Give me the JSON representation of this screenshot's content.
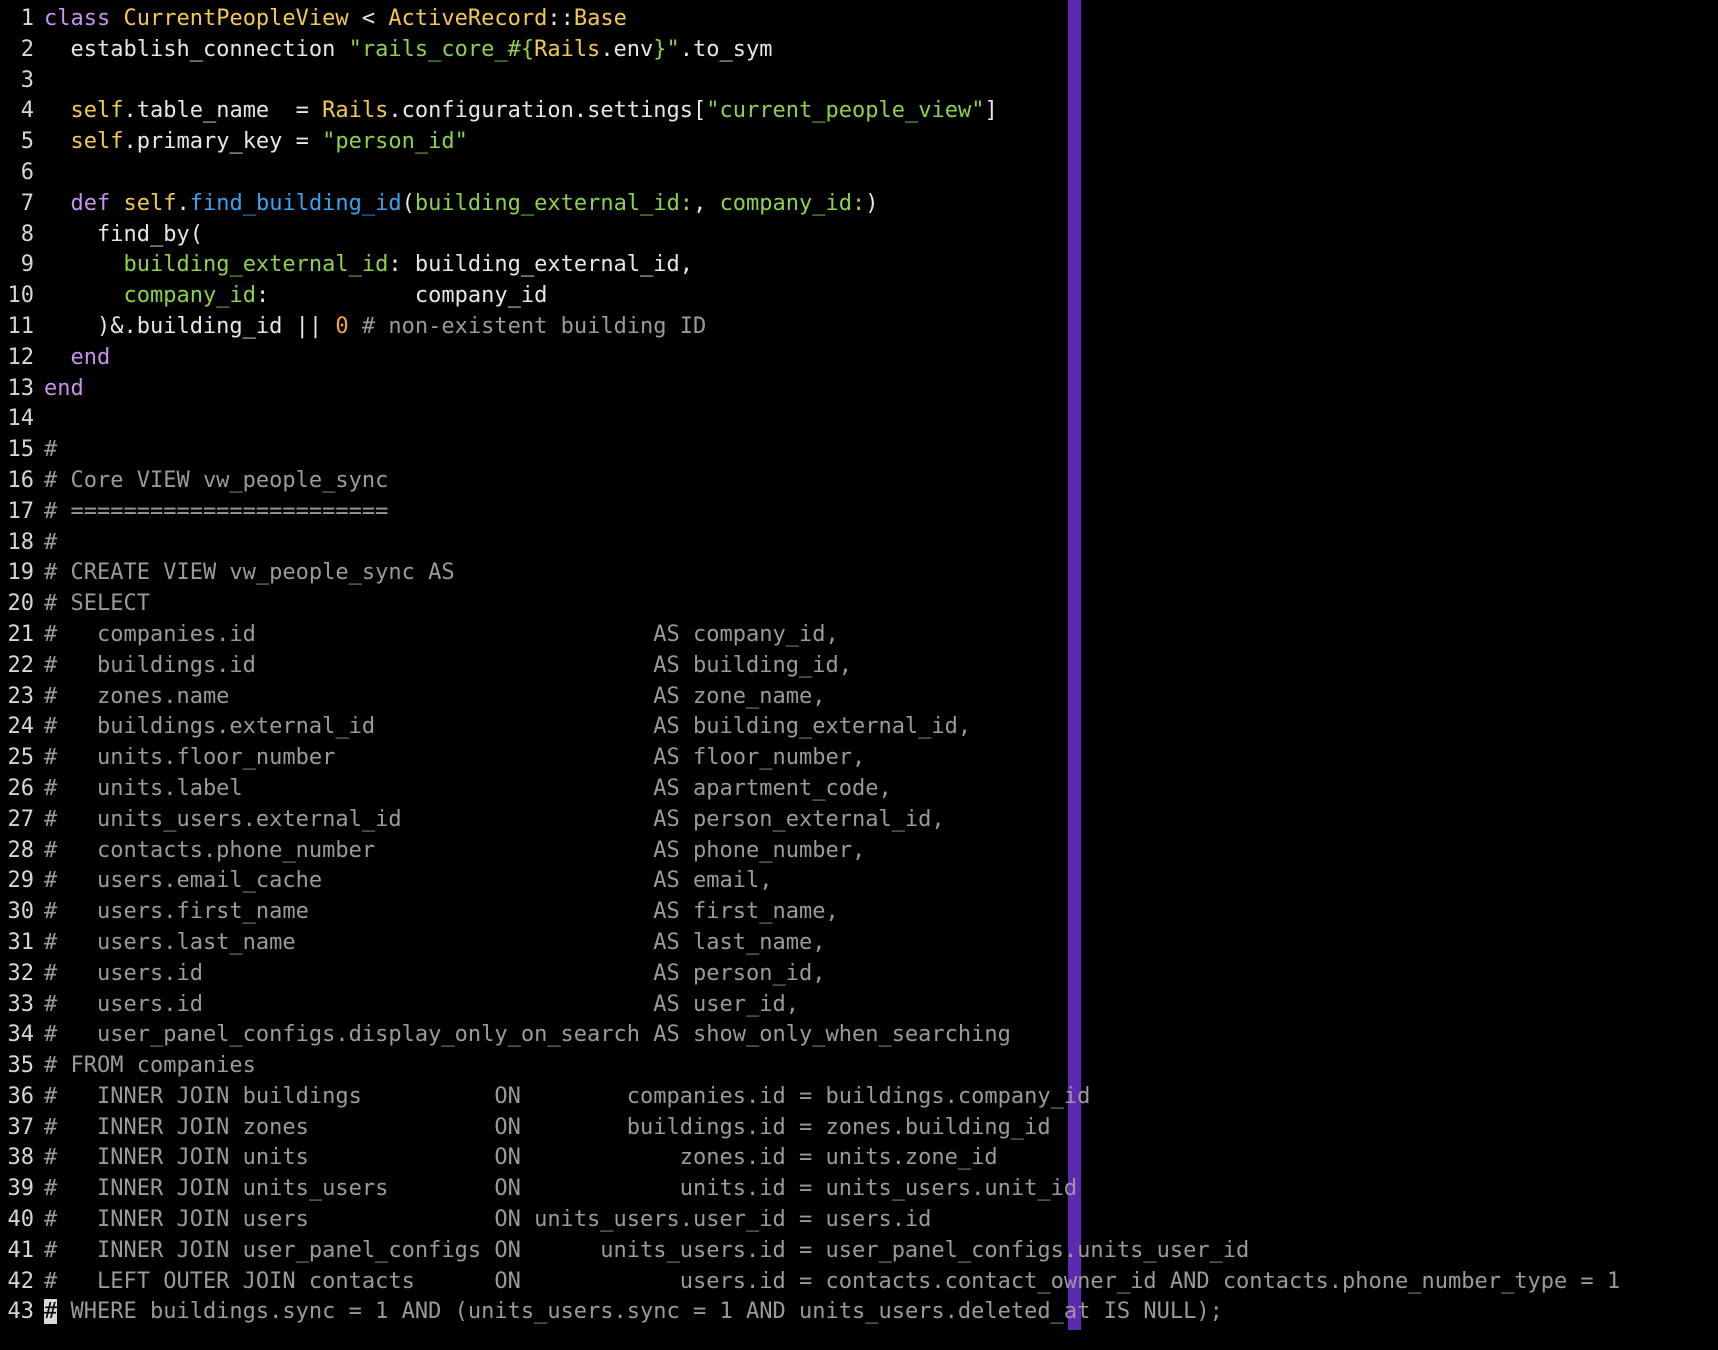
{
  "editor": {
    "accent_column_color": "#5b2ab0",
    "lines": [
      {
        "n": "1",
        "tokens": [
          {
            "t": "kw",
            "v": "class"
          },
          {
            "t": "txt",
            "v": " "
          },
          {
            "t": "cls",
            "v": "CurrentPeopleView"
          },
          {
            "t": "txt",
            "v": " < "
          },
          {
            "t": "cls",
            "v": "ActiveRecord"
          },
          {
            "t": "txt",
            "v": "::"
          },
          {
            "t": "cls",
            "v": "Base"
          }
        ]
      },
      {
        "n": "2",
        "tokens": [
          {
            "t": "txt",
            "v": "  establish_connection "
          },
          {
            "t": "str",
            "v": "\"rails_core_#{"
          },
          {
            "t": "cls",
            "v": "Rails"
          },
          {
            "t": "txt",
            "v": ".env"
          },
          {
            "t": "str",
            "v": "}\""
          },
          {
            "t": "txt",
            "v": ".to_sym"
          }
        ]
      },
      {
        "n": "3",
        "tokens": []
      },
      {
        "n": "4",
        "tokens": [
          {
            "t": "txt",
            "v": "  "
          },
          {
            "t": "cls",
            "v": "self"
          },
          {
            "t": "txt",
            "v": ".table_name  = "
          },
          {
            "t": "cls",
            "v": "Rails"
          },
          {
            "t": "txt",
            "v": ".configuration.settings["
          },
          {
            "t": "str",
            "v": "\"current_people_view\""
          },
          {
            "t": "txt",
            "v": "]"
          }
        ]
      },
      {
        "n": "5",
        "tokens": [
          {
            "t": "txt",
            "v": "  "
          },
          {
            "t": "cls",
            "v": "self"
          },
          {
            "t": "txt",
            "v": ".primary_key = "
          },
          {
            "t": "str",
            "v": "\"person_id\""
          }
        ]
      },
      {
        "n": "6",
        "tokens": []
      },
      {
        "n": "7",
        "tokens": [
          {
            "t": "txt",
            "v": "  "
          },
          {
            "t": "kw",
            "v": "def"
          },
          {
            "t": "txt",
            "v": " "
          },
          {
            "t": "cls",
            "v": "self"
          },
          {
            "t": "txt",
            "v": "."
          },
          {
            "t": "fn",
            "v": "find_building_id"
          },
          {
            "t": "txt",
            "v": "("
          },
          {
            "t": "sym",
            "v": "building_external_id:"
          },
          {
            "t": "txt",
            "v": ", "
          },
          {
            "t": "sym",
            "v": "company_id:"
          },
          {
            "t": "txt",
            "v": ")"
          }
        ]
      },
      {
        "n": "8",
        "tokens": [
          {
            "t": "txt",
            "v": "    find_by("
          }
        ]
      },
      {
        "n": "9",
        "tokens": [
          {
            "t": "txt",
            "v": "      "
          },
          {
            "t": "sym",
            "v": "building_external_id"
          },
          {
            "t": "txt",
            "v": ": building_external_id,"
          }
        ]
      },
      {
        "n": "10",
        "tokens": [
          {
            "t": "txt",
            "v": "      "
          },
          {
            "t": "sym",
            "v": "company_id"
          },
          {
            "t": "txt",
            "v": ":           company_id"
          }
        ]
      },
      {
        "n": "11",
        "tokens": [
          {
            "t": "txt",
            "v": "    )&.building_id || "
          },
          {
            "t": "num",
            "v": "0"
          },
          {
            "t": "txt",
            "v": " "
          },
          {
            "t": "cmt",
            "v": "# non-existent building ID"
          }
        ]
      },
      {
        "n": "12",
        "tokens": [
          {
            "t": "txt",
            "v": "  "
          },
          {
            "t": "kw",
            "v": "end"
          }
        ]
      },
      {
        "n": "13",
        "tokens": [
          {
            "t": "kw",
            "v": "end"
          }
        ]
      },
      {
        "n": "14",
        "tokens": []
      },
      {
        "n": "15",
        "tokens": [
          {
            "t": "cmt",
            "v": "#"
          }
        ]
      },
      {
        "n": "16",
        "tokens": [
          {
            "t": "cmt",
            "v": "# Core VIEW vw_people_sync"
          }
        ]
      },
      {
        "n": "17",
        "tokens": [
          {
            "t": "cmt",
            "v": "# ========================"
          }
        ]
      },
      {
        "n": "18",
        "tokens": [
          {
            "t": "cmt",
            "v": "#"
          }
        ]
      },
      {
        "n": "19",
        "tokens": [
          {
            "t": "cmt",
            "v": "# CREATE VIEW vw_people_sync AS"
          }
        ]
      },
      {
        "n": "20",
        "tokens": [
          {
            "t": "cmt",
            "v": "# SELECT"
          }
        ]
      },
      {
        "n": "21",
        "tokens": [
          {
            "t": "cmt",
            "v": "#   companies.id                              AS company_id,"
          }
        ]
      },
      {
        "n": "22",
        "tokens": [
          {
            "t": "cmt",
            "v": "#   buildings.id                              AS building_id,"
          }
        ]
      },
      {
        "n": "23",
        "tokens": [
          {
            "t": "cmt",
            "v": "#   zones.name                                AS zone_name,"
          }
        ]
      },
      {
        "n": "24",
        "tokens": [
          {
            "t": "cmt",
            "v": "#   buildings.external_id                     AS building_external_id,"
          }
        ]
      },
      {
        "n": "25",
        "tokens": [
          {
            "t": "cmt",
            "v": "#   units.floor_number                        AS floor_number,"
          }
        ]
      },
      {
        "n": "26",
        "tokens": [
          {
            "t": "cmt",
            "v": "#   units.label                               AS apartment_code,"
          }
        ]
      },
      {
        "n": "27",
        "tokens": [
          {
            "t": "cmt",
            "v": "#   units_users.external_id                   AS person_external_id,"
          }
        ]
      },
      {
        "n": "28",
        "tokens": [
          {
            "t": "cmt",
            "v": "#   contacts.phone_number                     AS phone_number,"
          }
        ]
      },
      {
        "n": "29",
        "tokens": [
          {
            "t": "cmt",
            "v": "#   users.email_cache                         AS email,"
          }
        ]
      },
      {
        "n": "30",
        "tokens": [
          {
            "t": "cmt",
            "v": "#   users.first_name                          AS first_name,"
          }
        ]
      },
      {
        "n": "31",
        "tokens": [
          {
            "t": "cmt",
            "v": "#   users.last_name                           AS last_name,"
          }
        ]
      },
      {
        "n": "32",
        "tokens": [
          {
            "t": "cmt",
            "v": "#   users.id                                  AS person_id,"
          }
        ]
      },
      {
        "n": "33",
        "tokens": [
          {
            "t": "cmt",
            "v": "#   users.id                                  AS user_id,"
          }
        ]
      },
      {
        "n": "34",
        "tokens": [
          {
            "t": "cmt",
            "v": "#   user_panel_configs.display_only_on_search AS show_only_when_searching"
          }
        ]
      },
      {
        "n": "35",
        "tokens": [
          {
            "t": "cmt",
            "v": "# FROM companies"
          }
        ]
      },
      {
        "n": "36",
        "tokens": [
          {
            "t": "cmt",
            "v": "#   INNER JOIN buildings          ON        companies.id = buildings.company_id"
          }
        ]
      },
      {
        "n": "37",
        "tokens": [
          {
            "t": "cmt",
            "v": "#   INNER JOIN zones              ON        buildings.id = zones.building_id"
          }
        ]
      },
      {
        "n": "38",
        "tokens": [
          {
            "t": "cmt",
            "v": "#   INNER JOIN units              ON            zones.id = units.zone_id"
          }
        ]
      },
      {
        "n": "39",
        "tokens": [
          {
            "t": "cmt",
            "v": "#   INNER JOIN units_users        ON            units.id = units_users.unit_id"
          }
        ]
      },
      {
        "n": "40",
        "tokens": [
          {
            "t": "cmt",
            "v": "#   INNER JOIN users              ON units_users.user_id = users.id"
          }
        ]
      },
      {
        "n": "41",
        "tokens": [
          {
            "t": "cmt",
            "v": "#   INNER JOIN user_panel_configs ON      units_users.id = user_panel_configs.units_user_id"
          }
        ]
      },
      {
        "n": "42",
        "tokens": [
          {
            "t": "cmt",
            "v": "#   LEFT OUTER JOIN contacts      ON            users.id = contacts.contact_owner_id AND contacts.phone_number_type = 1"
          }
        ]
      },
      {
        "n": "43",
        "tokens": [
          {
            "t": "cursor",
            "v": "#"
          },
          {
            "t": "cmt",
            "v": " WHERE buildings.sync = 1 AND (units_users.sync = 1 AND units_users.deleted_at IS NULL);"
          }
        ]
      }
    ]
  }
}
